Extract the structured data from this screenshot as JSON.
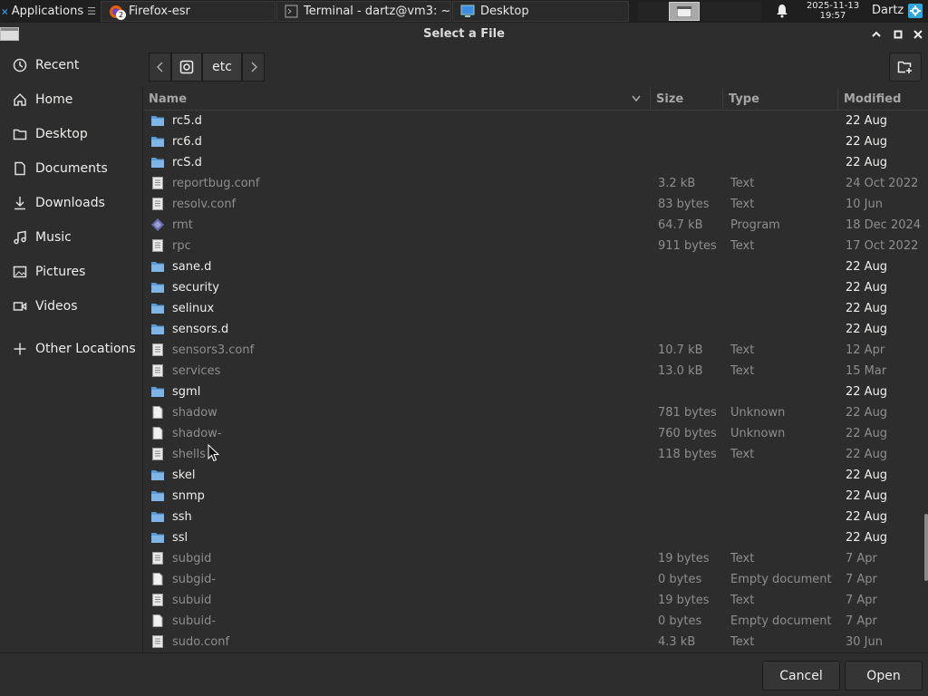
{
  "taskbar": {
    "apps_label": "Applications",
    "tasks": [
      {
        "label": "Firefox-esr",
        "badge": "2"
      },
      {
        "label": "Terminal - dartz@vm3: ~"
      },
      {
        "label": "Desktop"
      }
    ],
    "clock_date": "2025-11-13",
    "clock_time": "19:57",
    "user": "Dartz"
  },
  "dialog": {
    "title": "Select a File",
    "cancel_label": "Cancel",
    "open_label": "Open"
  },
  "sidebar": {
    "items": [
      {
        "label": "Recent",
        "icon": "clock-icon"
      },
      {
        "label": "Home",
        "icon": "home-icon"
      },
      {
        "label": "Desktop",
        "icon": "folder-icon"
      },
      {
        "label": "Documents",
        "icon": "document-icon"
      },
      {
        "label": "Downloads",
        "icon": "download-icon"
      },
      {
        "label": "Music",
        "icon": "music-icon"
      },
      {
        "label": "Pictures",
        "icon": "picture-icon"
      },
      {
        "label": "Videos",
        "icon": "video-icon"
      },
      {
        "label": "Other Locations",
        "icon": "plus-icon"
      }
    ]
  },
  "pathbar": {
    "current": "etc"
  },
  "columns": {
    "name": "Name",
    "size": "Size",
    "type": "Type",
    "modified": "Modified"
  },
  "files": [
    {
      "name": "rc5.d",
      "kind": "folder",
      "size": "",
      "type": "",
      "modified": "22 Aug"
    },
    {
      "name": "rc6.d",
      "kind": "folder",
      "size": "",
      "type": "",
      "modified": "22 Aug"
    },
    {
      "name": "rcS.d",
      "kind": "folder",
      "size": "",
      "type": "",
      "modified": "22 Aug"
    },
    {
      "name": "reportbug.conf",
      "kind": "text",
      "size": "3.2 kB",
      "type": "Text",
      "modified": "24 Oct 2022"
    },
    {
      "name": "resolv.conf",
      "kind": "text",
      "size": "83 bytes",
      "type": "Text",
      "modified": "10 Jun"
    },
    {
      "name": "rmt",
      "kind": "program",
      "size": "64.7 kB",
      "type": "Program",
      "modified": "18 Dec 2024"
    },
    {
      "name": "rpc",
      "kind": "text",
      "size": "911 bytes",
      "type": "Text",
      "modified": "17 Oct 2022"
    },
    {
      "name": "sane.d",
      "kind": "folder",
      "size": "",
      "type": "",
      "modified": "22 Aug"
    },
    {
      "name": "security",
      "kind": "folder",
      "size": "",
      "type": "",
      "modified": "22 Aug"
    },
    {
      "name": "selinux",
      "kind": "folder",
      "size": "",
      "type": "",
      "modified": "22 Aug"
    },
    {
      "name": "sensors.d",
      "kind": "folder",
      "size": "",
      "type": "",
      "modified": "22 Aug"
    },
    {
      "name": "sensors3.conf",
      "kind": "text",
      "size": "10.7 kB",
      "type": "Text",
      "modified": "12 Apr"
    },
    {
      "name": "services",
      "kind": "text",
      "size": "13.0 kB",
      "type": "Text",
      "modified": "15 Mar"
    },
    {
      "name": "sgml",
      "kind": "folder",
      "size": "",
      "type": "",
      "modified": "22 Aug"
    },
    {
      "name": "shadow",
      "kind": "blank",
      "size": "781 bytes",
      "type": "Unknown",
      "modified": "22 Aug"
    },
    {
      "name": "shadow-",
      "kind": "blank",
      "size": "760 bytes",
      "type": "Unknown",
      "modified": "22 Aug"
    },
    {
      "name": "shells",
      "kind": "text",
      "size": "118 bytes",
      "type": "Text",
      "modified": "22 Aug"
    },
    {
      "name": "skel",
      "kind": "folder",
      "size": "",
      "type": "",
      "modified": "22 Aug"
    },
    {
      "name": "snmp",
      "kind": "folder",
      "size": "",
      "type": "",
      "modified": "22 Aug"
    },
    {
      "name": "ssh",
      "kind": "folder",
      "size": "",
      "type": "",
      "modified": "22 Aug"
    },
    {
      "name": "ssl",
      "kind": "folder",
      "size": "",
      "type": "",
      "modified": "22 Aug"
    },
    {
      "name": "subgid",
      "kind": "text",
      "size": "19 bytes",
      "type": "Text",
      "modified": "7 Apr"
    },
    {
      "name": "subgid-",
      "kind": "blank",
      "size": "0 bytes",
      "type": "Empty document",
      "modified": "7 Apr"
    },
    {
      "name": "subuid",
      "kind": "text",
      "size": "19 bytes",
      "type": "Text",
      "modified": "7 Apr"
    },
    {
      "name": "subuid-",
      "kind": "blank",
      "size": "0 bytes",
      "type": "Empty document",
      "modified": "7 Apr"
    },
    {
      "name": "sudo.conf",
      "kind": "text",
      "size": "4.3 kB",
      "type": "Text",
      "modified": "30 Jun"
    }
  ],
  "colors": {
    "folder_icon": "#5b9bd5",
    "accent_user_icon": "#2ea7e0"
  }
}
